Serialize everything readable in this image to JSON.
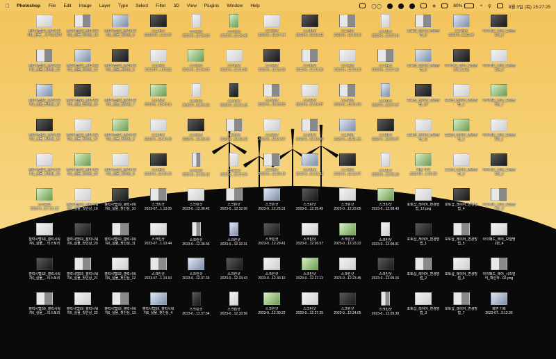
{
  "menubar": {
    "app_name": "Photoshop",
    "menus": [
      "File",
      "Edit",
      "Image",
      "Layer",
      "Type",
      "Select",
      "Filter",
      "3D",
      "View",
      "Plugins",
      "Window",
      "Help"
    ],
    "battery_percent": "80%",
    "datetime": "8월 3일 (목) 15:27:25"
  },
  "desktop": {
    "columns": [
      [
        "갤럭시탭S9_갤럭시워\n치6_실물_...0 티스토리",
        "갤럭시탭S9_갤럭시워\n치6_실물_첫인상_23",
        "갤럭시탭S9_갤럭시워\n치6_실물_첫인상_24",
        "갤럭시탭S9_갤럭시워\n치6_실물_첫인상_25",
        "갤럭시탭S9_갤럭시워\n치6_실물_첫인상_26",
        "스크린샷\n2023-0...8.7.15.12",
        "갤럭시탭S9_갤럭시워\n치6_실물_...티스토리",
        "갤럭시탭S9_갤럭시워\n치6_실물_...티스토리",
        "갤럭시탭S9_갤럭시워\n치6_실물_...티스토리"
      ],
      [
        "갤럭시탭S9_갤럭시워\n치6_실물_첫인상_14",
        "갤럭시탭S9_갤럭시워\n치6_실물_첫인상_35",
        "갤럭시탭S9_갤럭시워\n치6_실물_첫인상_36",
        "갤럭시탭S9_갤럭시워\n치6_실물_첫인상_37",
        "갤럭시탭S9_갤럭시워\n치6_실물_첫인상_38",
        "갤럭시탭S9_갤럭시워\n치6_실물_첫인상_19",
        "갤럭시탭S9_갤럭시워\n치6_실물_첫인상_20",
        "갤럭시탭S9_갤럭시워\n치6_실물_첫인상_21",
        "갤럭시탭S9_갤럭시워\n치6_실물_첫인상_22"
      ],
      [
        "갤럭시탭S9_갤럭시워\n치6_실물_첫인상_5",
        "갤럭시탭S9_갤럭시워\n치6_실물_첫인상_6",
        "갤럭시탭S9_갤럭시워\n치6_실물_첫인상_7",
        "갤럭시탭S9_갤럭시워\n치6_실물_첫인상_8",
        "갤럭시탭S9_갤럭시워\n치6_실물_첫인상_9",
        "갤럭시탭S9_갤럭시워\n치6_실물_첫인상_10",
        "갤럭시탭S9_갤럭시워\n치6_실물_첫인상_11",
        "갤럭시탭S9_갤럭시워\n치6_실물_첫인상_12",
        "갤럭시탭S9_갤럭시워\n치6_실물_첫인상_13"
      ],
      [
        "스크린샷\n2023-07...1.12.37",
        "스크린샷\n2023-07...4.55(2)",
        "스크린샷\n2023-0...12.45.11",
        "스크린샷\n2023-0...12.40.36",
        "스크린샷\n2023-0...12.36.13",
        "스크린샷\n2023-07...1.13.05",
        "스크린샷\n2023-07...1.13.44",
        "스크린샷\n2023-07...1.14.10",
        "갤럭시탭S9_갤럭시워\n치6_실물_첫인상_4"
      ],
      [
        "스크린샷\n2023-0...12.34.33",
        "스크린샷\n2023-0...12.34.55",
        "스크린샷\n2023-0...12.35.20",
        "스크린샷\n2023-0...12.33.33",
        "스크린샷\n2023-0...12.36.12",
        "스크린샷\n2023-0...12.36.42",
        "스크린샷\n2023-0...12.36.56",
        "스크린샷\n2023-0...12.37.33",
        "스크린샷\n2023-0...12.37.54"
      ],
      [
        "스크린샷\n2023-0...12.30.48",
        "스크린샷\n2023-0...12.31.04",
        "스크린샷\n2023-0...12.31.15",
        "스크린샷\n2023-0...12.32.32",
        "스크린샷\n2023-0...12.31.54",
        "스크린샷\n2023-0...12.32.06",
        "스크린샷\n2023-0...12.32.31",
        "스크린샷\n2023-0...12.33.43",
        "스크린샷\n2023-0...12.33.56"
      ],
      [
        "스크린샷\n2023-0...12.27.44",
        "스크린샷\n2023-0...12.28.26",
        "스크린샷\n2023-0...12.28.33",
        "스크린샷\n2023-0...12.24.07",
        "스크린샷\n2023-0...12.29.18",
        "스크린샷\n2023-0...12.29.31",
        "스크린샷\n2023-0...12.29.41",
        "스크린샷\n2023-0...12.30.10",
        "스크린샷\n2023-0...12.30.22"
      ],
      [
        "스크린샷\n2023-0...12.24.22",
        "스크린샷\n2023-0...12.24.36",
        "스크린샷\n2023-0...12.24.57",
        "스크린샷\n2023-0...12.25.30",
        "스크린샷\n2023-0...12.25.32",
        "스크린샷\n2023-0...12.25.49",
        "스크린샷\n2023-0...12.26.57",
        "스크린샷\n2023-0...12.27.12",
        "스크린샷\n2023-0...12.27.25"
      ],
      [
        "스크린샷\n2023-0...12.16.10",
        "스크린샷\n2023-0...12.20.19",
        "스크린샷\n2023-0...12.21.00",
        "스크린샷\n2023-0...12.21.35",
        "스크린샷\n2023-0...12.22.07",
        "스크린샷\n2023-0...12.23.05",
        "스크린샷\n2023-0...12.23.22",
        "스크린샷\n2023-0...12.23.45",
        "스크린샷\n2023-0...12.24.05"
      ],
      [
        "스크린샷\n2023-0...12.07.34",
        "스크린샷\n2023-0...12.07.42",
        "스크린샷\n2023-0...12.07.57",
        "스크린샷\n2023-0...12.08.07",
        "스크린샷\n2023-0...12.08.19",
        "스크린샷\n2023-0...12.08.43",
        "스크린샷\n2023-0...12.09.01",
        "스크린샷\n2023-0...12.09.16",
        "스크린샷\n2023-0...12.09.30"
      ],
      [
        "포토샵_레이어_변경방\n법_8",
        "포토샵_레이어_변경방\n법_9",
        "포토샵_레이어_변경방\n법_10",
        "포토샵_레이어_변경방\n법_11",
        "화면 기록\n2023-07...1.09.29",
        "포토샵_레이어_변경방\n법_12.png",
        "포토샵_레이어_변경방\n법_1",
        "포토샵_레이어_변경방\n법_2",
        "포토샵_레이어_변경방\n법_3"
      ],
      [
        "스크린샷\n2023-0...5.33.44",
        "아이패드_에어_모델명\n1번_8.png",
        "포토샵_레이어_변경방\n법_1",
        "포토샵_레이어_변경방\n법_2",
        "포토샵_레이어_변경방\n법_3",
        "포토샵_레이어_변경방\n법_4",
        "포토샵_레이어_변경방\n법_5",
        "포토샵_레이어_변경방\n법_6",
        "포토샵_레이어_변경방\n법_7"
      ],
      [
        "아이패드_에어_모델명\n1번_5",
        "아이패드_에어_모델명\n1번_6",
        "아이패드_에어_모델명\n1번_7",
        "아이패드_에어_모델명\n1번_1",
        "아이패드_에어_모델명\n1번_2",
        "아이패드_에어_모델명\n1번_3",
        "아이패드_에어_모델명\n1번_4",
        "아이패드_에어_시리얼\n키_확인하...02.png",
        "화면 기록\n2023-07...3.12.30"
      ]
    ]
  },
  "colors": {
    "sky_top": "#f5c45e",
    "sky_bottom": "#f7dd8a",
    "hill": "#0a0a0a"
  }
}
